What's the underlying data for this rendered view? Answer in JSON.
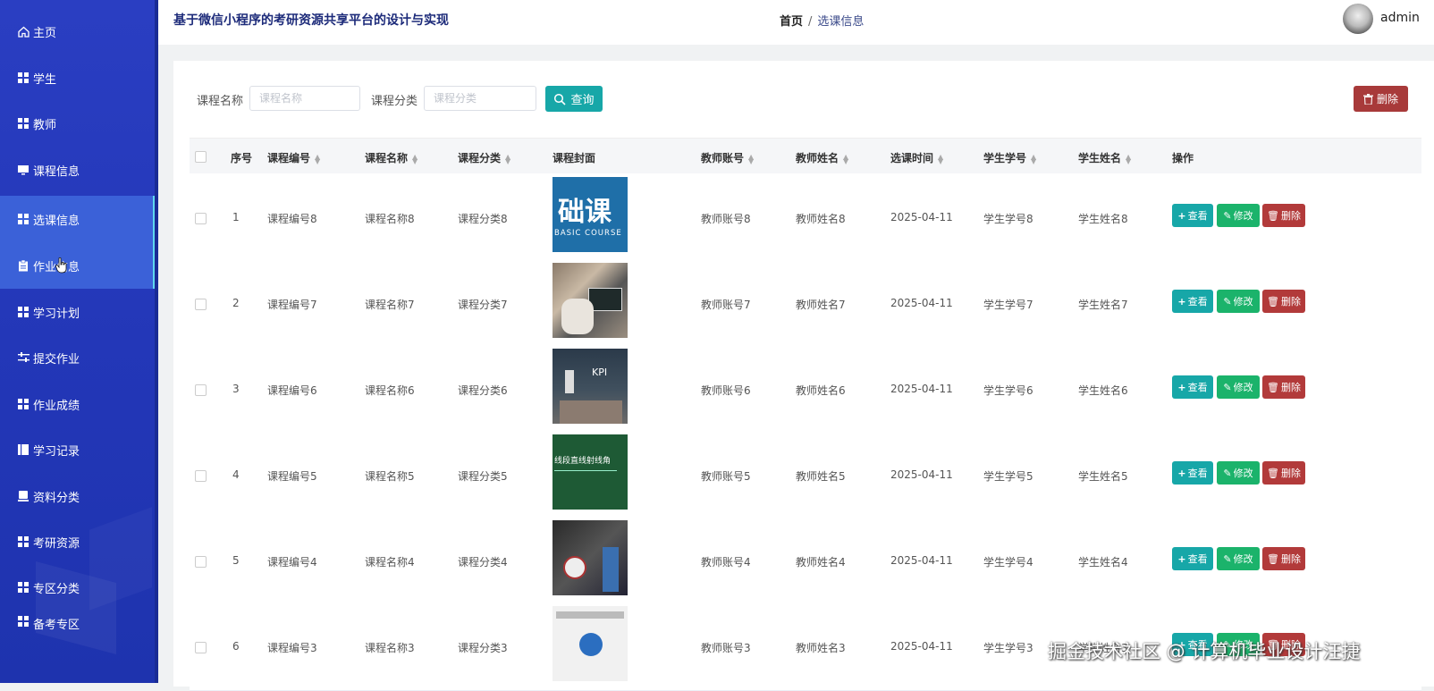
{
  "header": {
    "site_title": "基于微信小程序的考研资源共享平台的设计与实现",
    "breadcrumb_home": "首页",
    "breadcrumb_sep": "/",
    "breadcrumb_current": "选课信息",
    "username": "admin"
  },
  "sidebar": {
    "items": [
      {
        "label": "主页",
        "icon": "home-icon"
      },
      {
        "label": "学生",
        "icon": "grid-icon"
      },
      {
        "label": "教师",
        "icon": "grid-icon"
      },
      {
        "label": "课程信息",
        "icon": "monitor-icon"
      },
      {
        "label": "选课信息",
        "icon": "grid-icon"
      },
      {
        "label": "作业信息",
        "icon": "clipboard-icon"
      },
      {
        "label": "学习计划",
        "icon": "grid-icon"
      },
      {
        "label": "提交作业",
        "icon": "sliders-icon"
      },
      {
        "label": "作业成绩",
        "icon": "grid-icon"
      },
      {
        "label": "学习记录",
        "icon": "book-icon"
      },
      {
        "label": "资料分类",
        "icon": "box-icon"
      },
      {
        "label": "考研资源",
        "icon": "grid-icon"
      },
      {
        "label": "专区分类",
        "icon": "grid-icon"
      },
      {
        "label": "备考专区",
        "icon": "grid-icon"
      }
    ],
    "active_index": 4,
    "accent_color": "#5fd8ef"
  },
  "search": {
    "course_name_label": "课程名称",
    "course_name_placeholder": "课程名称",
    "course_category_label": "课程分类",
    "course_category_placeholder": "课程分类",
    "search_button": "查询",
    "delete_button": "删除"
  },
  "table": {
    "headers": {
      "index": "序号",
      "course_no": "课程编号",
      "course_name": "课程名称",
      "course_category": "课程分类",
      "course_cover": "课程封面",
      "teacher_account": "教师账号",
      "teacher_name": "教师姓名",
      "select_time": "选课时间",
      "student_no": "学生学号",
      "student_name": "学生姓名",
      "actions": "操作"
    },
    "actions": {
      "view": "查看",
      "edit": "修改",
      "delete": "删除"
    },
    "rows": [
      {
        "index": "1",
        "course_no": "课程编号8",
        "course_name": "课程名称8",
        "course_category": "课程分类8",
        "cover_text": "础课",
        "cover_sub": "BASIC COURSE",
        "teacher_account": "教师账号8",
        "teacher_name": "教师姓名8",
        "select_time": "2025-04-11",
        "student_no": "学生学号8",
        "student_name": "学生姓名8"
      },
      {
        "index": "2",
        "course_no": "课程编号7",
        "course_name": "课程名称7",
        "course_category": "课程分类7",
        "teacher_account": "教师账号7",
        "teacher_name": "教师姓名7",
        "select_time": "2025-04-11",
        "student_no": "学生学号7",
        "student_name": "学生姓名7"
      },
      {
        "index": "3",
        "course_no": "课程编号6",
        "course_name": "课程名称6",
        "course_category": "课程分类6",
        "cover_text": "KPI",
        "teacher_account": "教师账号6",
        "teacher_name": "教师姓名6",
        "select_time": "2025-04-11",
        "student_no": "学生学号6",
        "student_name": "学生姓名6"
      },
      {
        "index": "4",
        "course_no": "课程编号5",
        "course_name": "课程名称5",
        "course_category": "课程分类5",
        "cover_text": "线段直线射线角",
        "teacher_account": "教师账号5",
        "teacher_name": "教师姓名5",
        "select_time": "2025-04-11",
        "student_no": "学生学号5",
        "student_name": "学生姓名5"
      },
      {
        "index": "5",
        "course_no": "课程编号4",
        "course_name": "课程名称4",
        "course_category": "课程分类4",
        "teacher_account": "教师账号4",
        "teacher_name": "教师姓名4",
        "select_time": "2025-04-11",
        "student_no": "学生学号4",
        "student_name": "学生姓名4"
      },
      {
        "index": "6",
        "course_no": "课程编号3",
        "course_name": "课程名称3",
        "course_category": "课程分类3",
        "teacher_account": "教师账号3",
        "teacher_name": "教师姓名3",
        "select_time": "2025-04-11",
        "student_no": "学生学号3",
        "student_name": "学生姓名3"
      }
    ]
  },
  "watermark": "掘金技术社区 @ 计算机毕业设计汪捷"
}
